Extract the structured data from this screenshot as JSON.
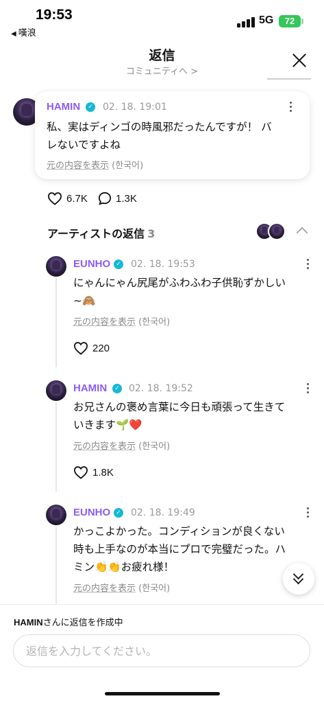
{
  "status_bar": {
    "time": "19:53",
    "back_app": "嘆浪",
    "network": "5G",
    "battery": "72"
  },
  "header": {
    "title": "返信",
    "subtitle": "コミュニティへ >"
  },
  "post": {
    "author": "HAMIN",
    "date": "02. 18. 19:01",
    "text_line1": "私、実はディンゴの時風邪だったんですが！ バ",
    "text_line2": "レないですよね",
    "translate_link": "元の内容を表示",
    "translate_lang": "(한국어)",
    "likes": "6.7K",
    "comments": "1.3K"
  },
  "artist_replies": {
    "title": "アーティストの返信",
    "count": "3",
    "replies": [
      {
        "author": "EUNHO",
        "date": "02. 18. 19:53",
        "line1": "にゃんにゃん尻尾がふわふわ子供恥ずかしい",
        "line2": "~🙈",
        "translate_link": "元の内容を表示",
        "translate_lang": "(한국어)",
        "likes": "220"
      },
      {
        "author": "HAMIN",
        "date": "02. 18. 19:52",
        "line1": "お兄さんの褒め言葉に今日も頑張って生きて",
        "line2": "いきます🌱❤️",
        "translate_link": "元の内容を表示",
        "translate_lang": "(한국어)",
        "likes": "1.8K"
      },
      {
        "author": "EUNHO",
        "date": "02. 18. 19:49",
        "line1": "かっこよかった。コンディションが良くない",
        "line2": "時も上手なのが本当にプロで完璧だった。ハ",
        "line3": "ミン👏👏お疲れ様！",
        "translate_link": "元の内容を表示",
        "translate_lang": "(한국어)"
      }
    ]
  },
  "composer": {
    "replying_to": "HAMIN",
    "replying_suffix": "さんに返信を作成中",
    "placeholder": "返信を入力してください。"
  },
  "colors": {
    "artist_name": "#8a5cf6",
    "verified_badge": "#15b8d6",
    "battery": "#34c759"
  }
}
